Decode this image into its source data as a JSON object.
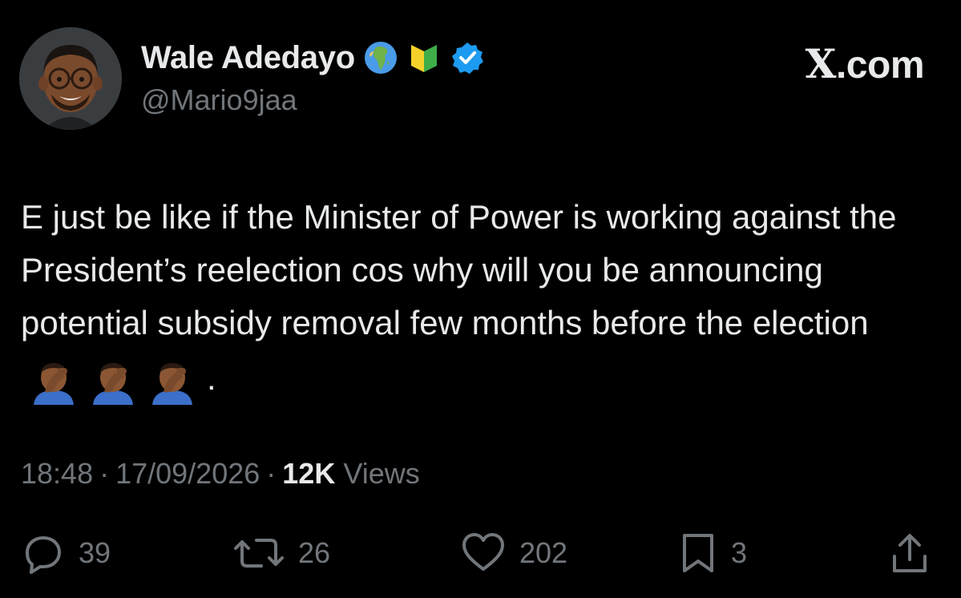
{
  "author": {
    "display_name": "Wale Adedayo",
    "handle": "@Mario9jaa",
    "badges": [
      "globe-africa-emoji",
      "beginner-badge-emoji",
      "verified-badge-icon"
    ]
  },
  "brand": {
    "logo_letter": "X",
    "logo_suffix": ".com"
  },
  "tweet": {
    "text": "E just be like if the Minister of Power is working against the President’s reelection cos why will you be announcing potential subsidy removal few months before the election",
    "trailing_emojis": [
      "man-facepalming-emoji",
      "man-facepalming-emoji",
      "man-facepalming-emoji"
    ],
    "trailing_punct": "."
  },
  "meta": {
    "time": "18:48",
    "separator": "·",
    "date": "17/09/2026",
    "views_count": "12K",
    "views_label": "Views"
  },
  "actions": {
    "replies": "39",
    "reposts": "26",
    "likes": "202",
    "bookmarks": "3"
  },
  "colors": {
    "background": "#000000",
    "text_primary": "#e7e9ea",
    "text_secondary": "#71767b",
    "verified_blue": "#1d9bf0"
  }
}
